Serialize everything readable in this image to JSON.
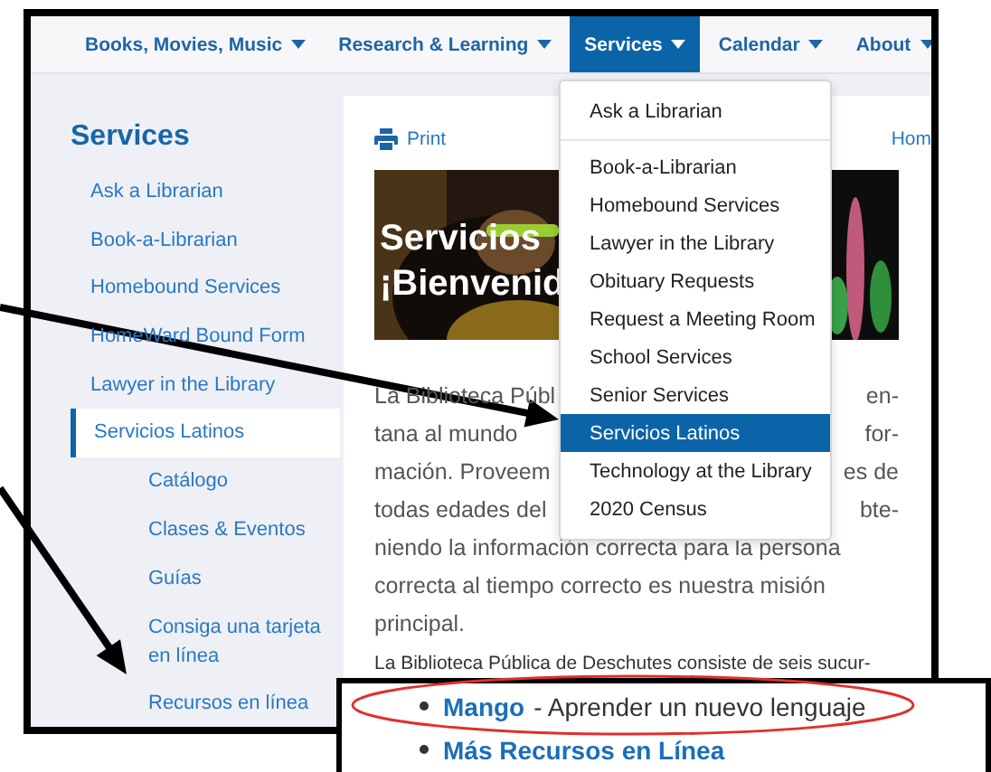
{
  "nav": {
    "items": [
      {
        "label": "Books, Movies, Music",
        "selected": false
      },
      {
        "label": "Research & Learning",
        "selected": false
      },
      {
        "label": "Services",
        "selected": true
      },
      {
        "label": "Calendar",
        "selected": false
      },
      {
        "label": "About",
        "selected": false
      }
    ]
  },
  "services_menu": {
    "items": [
      {
        "label": "Ask a Librarian",
        "selected": false,
        "divider_after": true
      },
      {
        "label": "Book-a-Librarian",
        "selected": false,
        "divider_after": false
      },
      {
        "label": "Homebound Services",
        "selected": false,
        "divider_after": false
      },
      {
        "label": "Lawyer in the Library",
        "selected": false,
        "divider_after": false
      },
      {
        "label": "Obituary Requests",
        "selected": false,
        "divider_after": false
      },
      {
        "label": "Request a Meeting Room",
        "selected": false,
        "divider_after": false
      },
      {
        "label": "School Services",
        "selected": false,
        "divider_after": false
      },
      {
        "label": "Senior Services",
        "selected": false,
        "divider_after": false
      },
      {
        "label": "Servicios Latinos",
        "selected": true,
        "divider_after": false
      },
      {
        "label": "Technology at the Library",
        "selected": false,
        "divider_after": false
      },
      {
        "label": "2020 Census",
        "selected": false,
        "divider_after": false
      }
    ]
  },
  "sidebar": {
    "title": "Services",
    "items": [
      {
        "label": "Ask a Librarian",
        "selected": false
      },
      {
        "label": "Book-a-Librarian",
        "selected": false
      },
      {
        "label": "Homebound Services",
        "selected": false
      },
      {
        "label": "HomeWard Bound Form",
        "selected": false
      },
      {
        "label": "Lawyer in the Library",
        "selected": false
      },
      {
        "label": "Servicios Latinos",
        "selected": true,
        "children": [
          {
            "label": "Catálogo",
            "selected": false
          },
          {
            "label": "Clases & Eventos",
            "selected": false
          },
          {
            "label": "Guías",
            "selected": false
          },
          {
            "label": "Consiga una tarjeta en línea",
            "selected": false
          },
          {
            "label": "Recursos en línea",
            "selected": false
          }
        ]
      }
    ]
  },
  "content": {
    "print": "Print",
    "breadcrumb": "Hom",
    "hero": {
      "kind": "picture",
      "title_lines": [
        "Servicios",
        "¡Bienvenid"
      ]
    },
    "paragraph_lines": [
      {
        "left": "La Biblioteca Públ",
        "right": "en-"
      },
      {
        "left": "tana al mundo",
        "right": "for-"
      },
      {
        "left": "mación. Proveem",
        "right": "es de"
      },
      {
        "left": "todas edades del",
        "right": "bte-"
      },
      {
        "left": "niendo la información correcta para la persona"
      },
      {
        "left": "correcta al tiempo correcto es nuestra misión"
      },
      {
        "left": "principal."
      }
    ],
    "note": "La Biblioteca Pública de Deschutes consiste de seis sucur-"
  },
  "inset": {
    "items": [
      {
        "link": "Mango",
        "text": "- Aprender un nuevo lenguaje"
      },
      {
        "link": "Más Recursos en Línea"
      }
    ]
  }
}
